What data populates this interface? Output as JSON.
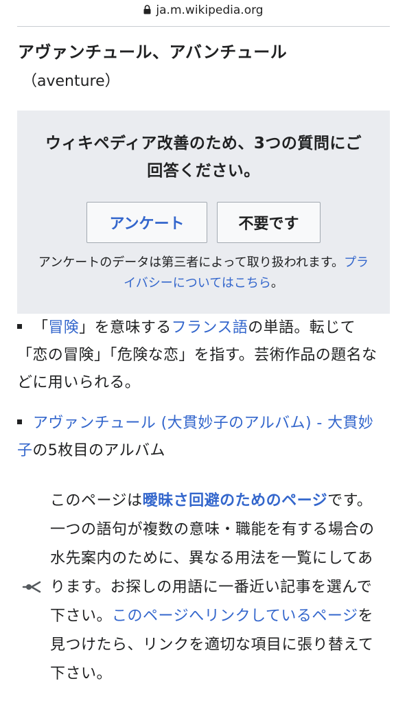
{
  "browser": {
    "url": "ja.m.wikipedia.org"
  },
  "entry": {
    "title": "アヴァンチュール、アバンチュール",
    "subtitle": "（aventure）"
  },
  "survey": {
    "question": "ウィキペディア改善のため、3つの質問にご回答ください。",
    "yes_label": "アンケート",
    "no_label": "不要です",
    "note_prefix": "アンケートのデータは第三者によって取り扱われます。",
    "privacy_link": "プライバシーについてはこちら",
    "note_suffix": "。"
  },
  "bullets": [
    {
      "open": "「",
      "link1": "冒険",
      "text1": "」を意味する",
      "link2": "フランス語",
      "text2": "の単語。転じて「恋の冒険」「危険な恋」を指す。芸術作品の題名などに用いられる。"
    },
    {
      "link1": "アヴァンチュール (大貫妙子のアルバム)",
      "sep": " - ",
      "link2": "大貫妙子",
      "text": "の5枚目のアルバム"
    }
  ],
  "disambiguation": {
    "text1": "このページは",
    "strong_link": "曖昧さ回避のためのページ",
    "text2": "です。一つの語句が複数の意味・職能を有する場合の水先案内のために、異なる用法を一覧にしてあります。お探しの用語に一番近い記事を選んで下さい。",
    "link": "このページへリンクしているページ",
    "text3": "を見つけたら、リンクを適切な項目に張り替えて下さい。"
  },
  "icons": {
    "lock": "lock-icon",
    "disambiguation": "disambiguation-icon"
  }
}
